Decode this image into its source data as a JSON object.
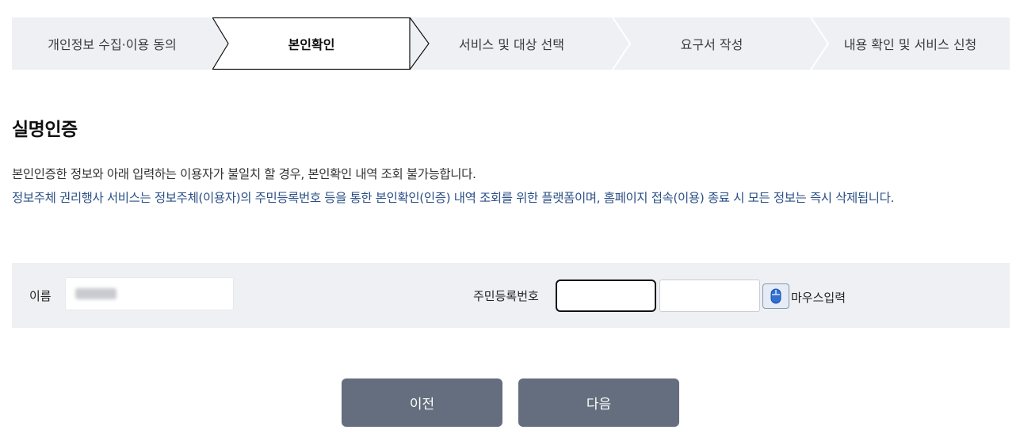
{
  "stepper": {
    "steps": [
      {
        "label": "개인정보 수집·이용 동의",
        "active": false
      },
      {
        "label": "본인확인",
        "active": true
      },
      {
        "label": "서비스 및 대상 선택",
        "active": false
      },
      {
        "label": "요구서 작성",
        "active": false
      },
      {
        "label": "내용 확인 및 서비스 신청",
        "active": false
      }
    ]
  },
  "main": {
    "title": "실명인증",
    "description_line1": "본인인증한 정보와 아래 입력하는 이용자가 불일치 할 경우, 본인확인 내역 조회 불가능합니다.",
    "description_line2": "정보주체 권리행사 서비스는 정보주체(이용자)의 주민등록번호 등을 통한 본인확인(인증) 내역 조회를 위한 플랫폼이며, 홈페이지 접속(이용) 종료 시 모든 정보는 즉시 삭제됩니다."
  },
  "form": {
    "name_label": "이름",
    "name_value": "",
    "rrn_label": "주민등록번호",
    "rrn_front_value": "",
    "rrn_back_value": "",
    "mouse_input_label": "마우스입력",
    "mouse_icon": "mouse-icon"
  },
  "buttons": {
    "prev_label": "이전",
    "next_label": "다음"
  },
  "colors": {
    "panel_bg": "#eef0f4",
    "notice_text": "#2a4f86",
    "button_bg": "#646e7e"
  }
}
